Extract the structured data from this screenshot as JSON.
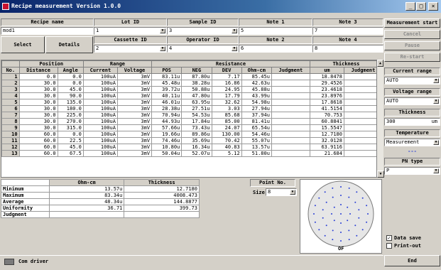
{
  "window": {
    "title": "Recipe measurement Version 1.0.0"
  },
  "header": {
    "recipe_name_label": "Recipe name",
    "recipe_name_value": "mod1",
    "lot_id_label": "Lot ID",
    "lot_id_value": "1",
    "sample_id_label": "Sample ID",
    "sample_id_value": "3",
    "note1_label": "Note 1",
    "note1_value": "5",
    "note3_label": "Note 3",
    "note3_value": "7",
    "cassette_id_label": "Cassette ID",
    "cassette_id_value": "2",
    "operator_id_label": "Operator ID",
    "operator_id_value": "4",
    "note2_label": "Note 2",
    "note2_value": "6",
    "note4_label": "Note 4",
    "note4_value": "8",
    "select_label": "Select",
    "details_label": "Details"
  },
  "table": {
    "group_headers": [
      "Position",
      "Range",
      "Resistance",
      "Thickness"
    ],
    "columns": [
      "No.",
      "Distance",
      "Angle",
      "Current",
      "Voltage",
      "POS",
      "NEG",
      "DEV",
      "Ohm-cm",
      "Judgment",
      "um",
      "Judgment"
    ],
    "rows": [
      [
        "1",
        "0.0",
        "0.0",
        "100uA",
        "3mV",
        "83.11u",
        "87.80u",
        "7.17",
        "85.45u",
        "",
        "18.8478",
        ""
      ],
      [
        "2",
        "30.0",
        "0.0",
        "100uA",
        "3mV",
        "45.48u",
        "38.28u",
        "16.86",
        "42.63u",
        "",
        "29.4526",
        ""
      ],
      [
        "3",
        "30.0",
        "45.0",
        "100uA",
        "3mV",
        "39.72u",
        "50.88u",
        "24.95",
        "45.88u",
        "",
        "23.4618",
        ""
      ],
      [
        "4",
        "30.0",
        "90.0",
        "100uA",
        "3mV",
        "40.11u",
        "47.80u",
        "17.79",
        "43.99u",
        "",
        "23.8976",
        ""
      ],
      [
        "5",
        "30.0",
        "135.0",
        "100uA",
        "3mV",
        "46.01u",
        "63.95u",
        "32.62",
        "54.98u",
        "",
        "17.8618",
        ""
      ],
      [
        "6",
        "30.0",
        "180.0",
        "100uA",
        "3mV",
        "28.38u",
        "27.51u",
        "3.03",
        "27.94u",
        "",
        "41.5154",
        ""
      ],
      [
        "7",
        "30.0",
        "225.0",
        "100uA",
        "3mV",
        "70.94u",
        "54.53u",
        "85.68",
        "37.94u",
        "",
        "70.753",
        ""
      ],
      [
        "8",
        "30.0",
        "270.0",
        "100uA",
        "3mV",
        "44.93u",
        "17.84u",
        "85.00",
        "81.41u",
        "",
        "60.8841",
        ""
      ],
      [
        "9",
        "30.0",
        "315.0",
        "100uA",
        "3mV",
        "57.66u",
        "73.43u",
        "24.07",
        "65.54u",
        "",
        "15.5547",
        ""
      ],
      [
        "10",
        "60.0",
        "0.0",
        "100uA",
        "3mV",
        "19.66u",
        "89.86u",
        "130.00",
        "54.46u",
        "",
        "12.7180",
        ""
      ],
      [
        "11",
        "60.0",
        "22.5",
        "100uA",
        "3mV",
        "74.46u",
        "35.69u",
        "70.42",
        "55.07u",
        "",
        "32.0128",
        ""
      ],
      [
        "12",
        "60.0",
        "45.0",
        "100uA",
        "3mV",
        "10.80u",
        "16.34u",
        "40.83",
        "13.57u",
        "",
        "63.9116",
        ""
      ],
      [
        "13",
        "60.0",
        "67.5",
        "100uA",
        "3mV",
        "50.04u",
        "52.07u",
        "5.12",
        "51.80u",
        "",
        "21.684",
        ""
      ]
    ]
  },
  "summary": {
    "col_ohm": "Ohm-cm",
    "col_thk": "Thickness",
    "rows": [
      {
        "label": "Minimum",
        "ohm": "13.57u",
        "thk": "12.7180"
      },
      {
        "label": "Maximum",
        "ohm": "83.34u",
        "thk": "4008.473"
      },
      {
        "label": "Average",
        "ohm": "48.34u",
        "thk": "144.8877"
      },
      {
        "label": "Uniformity",
        "ohm": "36.71",
        "thk": "399.73"
      },
      {
        "label": "Judgment",
        "ohm": "",
        "thk": ""
      }
    ]
  },
  "point": {
    "label": "Point No.",
    "size_label": "Size",
    "size_value": "8",
    "wafer_bottom_label": "OF"
  },
  "right": {
    "measurement_start": "Measurement start",
    "cancel": "Cancel",
    "pause": "Pause",
    "restart": "Re-start",
    "current_range_label": "Current range",
    "current_range_value": "AUTO",
    "voltage_range_label": "Voltage range",
    "voltage_range_value": "AUTO",
    "thickness_label": "Thickness",
    "thickness_value": "300",
    "thickness_unit": "um",
    "temperature_label": "Temperature",
    "temperature_value": "Measurement",
    "temperature_readout": "---",
    "pn_type_label": "PN type",
    "pn_type_value": "P",
    "data_save": "Data save",
    "print_out": "Print-out",
    "end": "End"
  },
  "taskbar": {
    "item": "Com driver"
  }
}
